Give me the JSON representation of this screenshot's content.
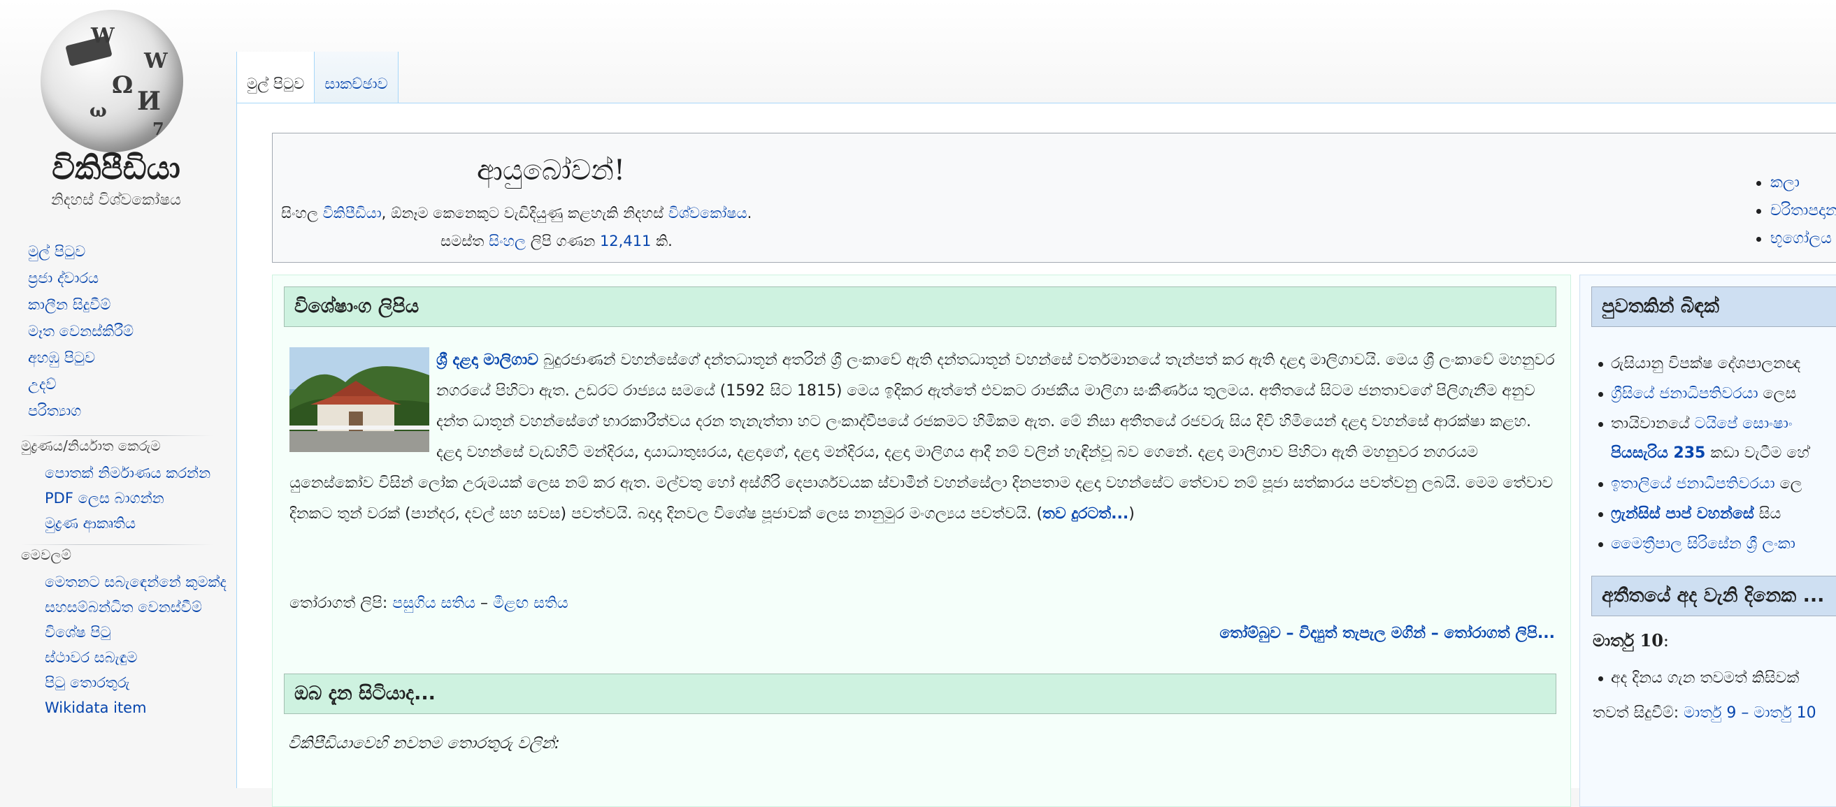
{
  "logo": {
    "wordmark": "විකිපීඩියා",
    "tagline": "නිදහස් විශ්වකෝෂය"
  },
  "sidebar": {
    "nav": [
      {
        "label": "මුල් පිටුව"
      },
      {
        "label": "ප්‍රජා ද්වාරය"
      },
      {
        "label": "කාලීන සිදුවීම්"
      },
      {
        "label": "මෑත වෙනස්කිරීම්"
      },
      {
        "label": "අහඹු පිටුව"
      },
      {
        "label": "උදව්"
      },
      {
        "label": "පරිත්‍යාග"
      }
    ],
    "print": {
      "heading": "මුද්‍රණය/නිර්යාත කෙරුම",
      "items": [
        {
          "label": "පොතක් නිර්මාණය කරන්න"
        },
        {
          "label": "PDF ලෙස බාගන්න"
        },
        {
          "label": "මුද්‍රණ ආකෘතිය"
        }
      ]
    },
    "tools": {
      "heading": "මෙවලම්",
      "items": [
        {
          "label": "මෙතනට සබැඳෙන්නේ කුමක්ද"
        },
        {
          "label": "සහසම්බන්ධිත වෙනස්වීම්"
        },
        {
          "label": "විශේෂ පිටු"
        },
        {
          "label": "ස්ථාවර සබැඳුම"
        },
        {
          "label": "පිටු තොරතුරු"
        },
        {
          "label": "Wikidata item"
        }
      ]
    }
  },
  "tabs": [
    {
      "label": "මුල් පිටුව"
    },
    {
      "label": "සාකච්ඡාව"
    }
  ],
  "welcome": {
    "title": "ආයුබෝවන්!",
    "line1_pre": "සිංහල ",
    "line1_link1": "විකිපීඩියා",
    "line1_mid": ", ඕනෑම කෙනෙකුට වැඩිදියුණු කළහැකි නිදහස් ",
    "line1_link2": "විශ්වකෝෂය",
    "line1_post": ".",
    "line2_pre": "සමස්ත ",
    "line2_link1": "සිංහල",
    "line2_mid": " ලිපි ගණන ",
    "line2_count": "12,411",
    "line2_post": " කි.",
    "portals": [
      {
        "label": "කලා"
      },
      {
        "label": "චරිතාපදාන"
      },
      {
        "label": "භූගෝලය"
      }
    ]
  },
  "featured": {
    "heading": "විශේෂාංග ලිපිය",
    "article_link": "ශ්‍රී දළදා මාලිගාව",
    "article_text": " බුදුරජාණන් වහන්සේගේ දන්තධාතූන් අතරින් ශ්‍රී ලංකාවේ ඇති දන්තධාතූන් වහන්සේ වර්තමානයේ තැන්පත් කර ඇති දළදා මාලිගාවයි. මෙය ශ්‍රී ලංකාවේ මහනුවර නගරයේ පිහිටා ඇත. උඩරට රාජ්‍යය සමයේ (1592 සිට 1815) මෙය ඉදිකර ඇත්තේ එවකට රාජකීය මාලිගා සංකීර්ණය තුලමය. අතීතයේ සිටම ජනතාවගේ පිලිගැනීම අනුව දන්ත ධාතූන් වහන්සේගේ භාරකාරීත්වය දරන තැනැත්තා හට ලංකාද්වීපයේ රජකමට හිමිකම ඇත. මේ නිසා අතීතයේ රජවරු සිය දිවි හිමියෙන් දළදා වහන්සේ ආරක්ෂා කළහ. දළදා වහන්සේ වැඩහිටි මන්දිරය, දායාධාතුඝරය, දළදාගේ, දළදා මන්දිරය, දළදා මාලිගය ආදී නම් වලින් හැඳින්වූ බව ගෙනේ. දළදා මාලිගාව පිහිටා ඇති මහනුවර නගරයම යුනෙස්කෝව විසින් ලෝක උරුමයක් ලෙස නම් කර ඇත. මල්වතු හෝ අස්ගිරි දෙපාර්ශවයක ස්වාමීන් වහන්සේලා දිනපතාම දළදා වහන්සේට තේවාව නම් පූජා සත්කාරය පවත්වනු ලබයි. මෙම තේවාව දිනකට තුන් වරක් (පාන්දර, දවල් සහ සවස) පවත්වයි. බදාදා දිනවල විශේෂ පූජාවක් ලෙස නානුමුර මංගල්‍යය පවත්වයි. (",
    "read_more": "තව දුරටත්...",
    "read_more_post": ")",
    "recent_label": "තෝරාගත් ලිපි: ",
    "recent_1": "පසුගිය සතිය",
    "recent_sep": " – ",
    "recent_2": "මීළඟ සතිය",
    "more_1": "තෝම්බුව",
    "more_sep1": " – ",
    "more_2": "විද්‍යුත් තැපැල මගින්",
    "more_sep2": " – ",
    "more_3": "තෝරාගත් ලිපි..."
  },
  "dyk": {
    "heading": "ඔබ දැන සිටියාද...",
    "intro": "විකිපීඩියාවෙහි නවතම තොරතුරු වලින්:"
  },
  "news": {
    "heading": "පුවතකින් බිඳක්",
    "items": [
      {
        "text": "රුසියානු විපක්ෂ දේශපාලනඥ"
      },
      {
        "link": "ග්‍රීසියේ ජනාධිපතිවරයා",
        "text": " ලෙස"
      },
      {
        "pre": "තායිවානයේ ",
        "link": "ටයිපේ සොංෂාං",
        "line2": "පියසැරිය 235",
        "post": " කඩා වැටීම හේ"
      },
      {
        "link": "ඉතාලියේ ජනාධිපතිවරයා",
        "text": " ලෙ"
      },
      {
        "link": "ෆ්‍රැන්සිස් පාප් වහන්සේ",
        "text": " සිය"
      },
      {
        "link": "මෛත්‍රීපාල සිරිසේන ශ්‍රී ලංකා",
        "text": ""
      }
    ]
  },
  "onthisday": {
    "heading": "අතීතයේ අද වැනි දිනෙක ...",
    "date": "මාර්තු 10",
    "date_post": ":",
    "items": [
      {
        "text": "අද දිනය ගැන තවමත් කිසිවක්"
      }
    ],
    "other_label": "තවත් සිදුවීම්: ",
    "other_1": "මාර්තු 9",
    "other_sep": " – ",
    "other_2": "මාර්තු 10"
  },
  "colors": {
    "link": "#0645ad",
    "featured_bg": "#f5fffa",
    "featured_head": "#cef2e0",
    "news_bg": "#f5faff",
    "news_head": "#cedff2"
  }
}
